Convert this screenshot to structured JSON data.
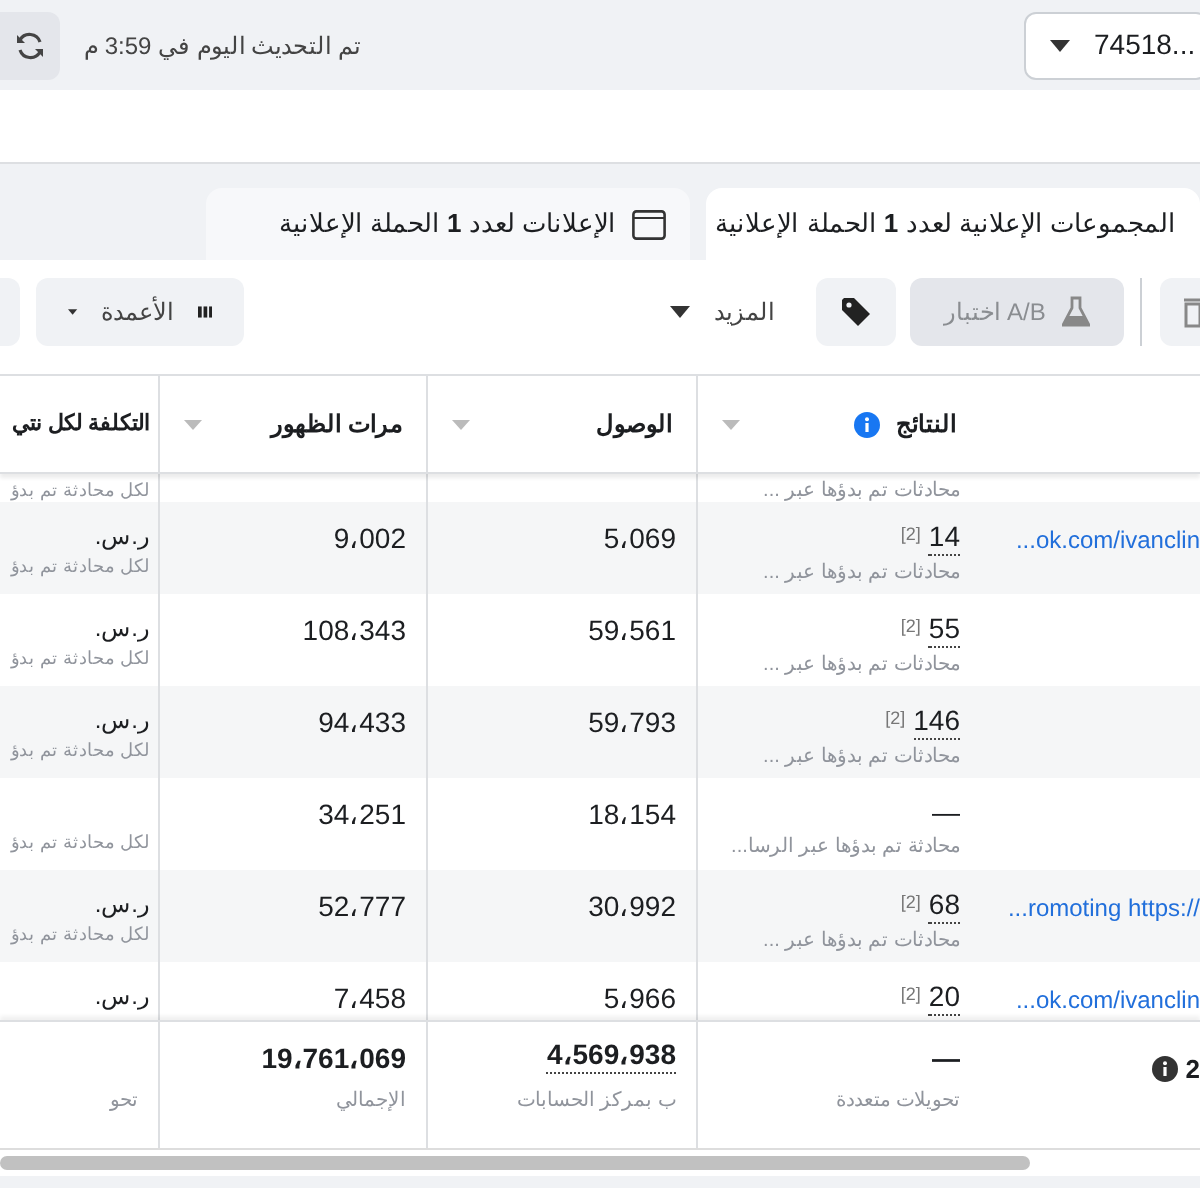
{
  "header": {
    "account": "74518...",
    "updated": "تم التحديث اليوم في 3:59 م"
  },
  "tabs": [
    {
      "label": "المجموعات الإعلانية لعدد **1** الحملة الإعلانية",
      "selected": true
    },
    {
      "label": "الإعلانات لعدد **1** الحملة الإعلانية",
      "selected": false
    }
  ],
  "toolbar": {
    "ab_test": {
      "label": "اختبار A/B",
      "disabled": true
    },
    "more": "المزيد",
    "columns": "الأعمدة"
  },
  "table": {
    "columns": [
      {
        "label": "النتائج",
        "sortable": true
      },
      {
        "label": "الوصول",
        "sortable": true
      },
      {
        "label": "مرات الظهور",
        "sortable": true
      },
      {
        "label": "التكلفة لكل نتي",
        "sortable": false
      }
    ],
    "top_partial": {
      "result_sub": "محادثات تم بدؤها عبر ...",
      "cost_sub": "لكل محادثة تم بدؤ"
    },
    "rows": [
      {
        "name": "...ok.com/ivanclin",
        "result": "14",
        "mark": "[2]",
        "result_sub": "محادثات تم بدؤها عبر ...",
        "reach": "5،069",
        "impressions": "9،002",
        "cost": "ر.س.",
        "cost_sub": "لكل محادثة تم بدؤ"
      },
      {
        "result": "55",
        "mark": "[2]",
        "result_sub": "محادثات تم بدؤها عبر ...",
        "reach": "59،561",
        "impressions": "108،343",
        "cost": "ر.س.",
        "cost_sub": "لكل محادثة تم بدؤ"
      },
      {
        "result": "146",
        "mark": "[2]",
        "result_sub": "محادثات تم بدؤها عبر ...",
        "reach": "59،793",
        "impressions": "94،433",
        "cost": "ر.س.",
        "cost_sub": "لكل محادثة تم بدؤ"
      },
      {
        "result": "—",
        "result_sub": "محادثة تم بدؤها عبر الرسا...",
        "reach": "18،154",
        "impressions": "34،251",
        "cost_sub": "لكل محادثة تم بدؤ"
      },
      {
        "name": "...romoting https://",
        "result": "68",
        "mark": "[2]",
        "result_sub": "محادثات تم بدؤها عبر ...",
        "reach": "30،992",
        "impressions": "52،777",
        "cost": "ر.س.",
        "cost_sub": "لكل محادثة تم بدؤ"
      },
      {
        "name": "...ok.com/ivanclin",
        "result": "20",
        "mark": "[2]",
        "reach": "5،966",
        "impressions": "7،458",
        "cost": "ر.س."
      }
    ],
    "footer": {
      "name": "2",
      "result": "—",
      "result_sub": "تحويلات متعددة",
      "reach": "4،569،938",
      "reach_sub": "ب بمركز الحسابات",
      "impressions": "19،761،069",
      "impressions_sub": "الإجمالي",
      "cost_sub": "تحو"
    }
  }
}
